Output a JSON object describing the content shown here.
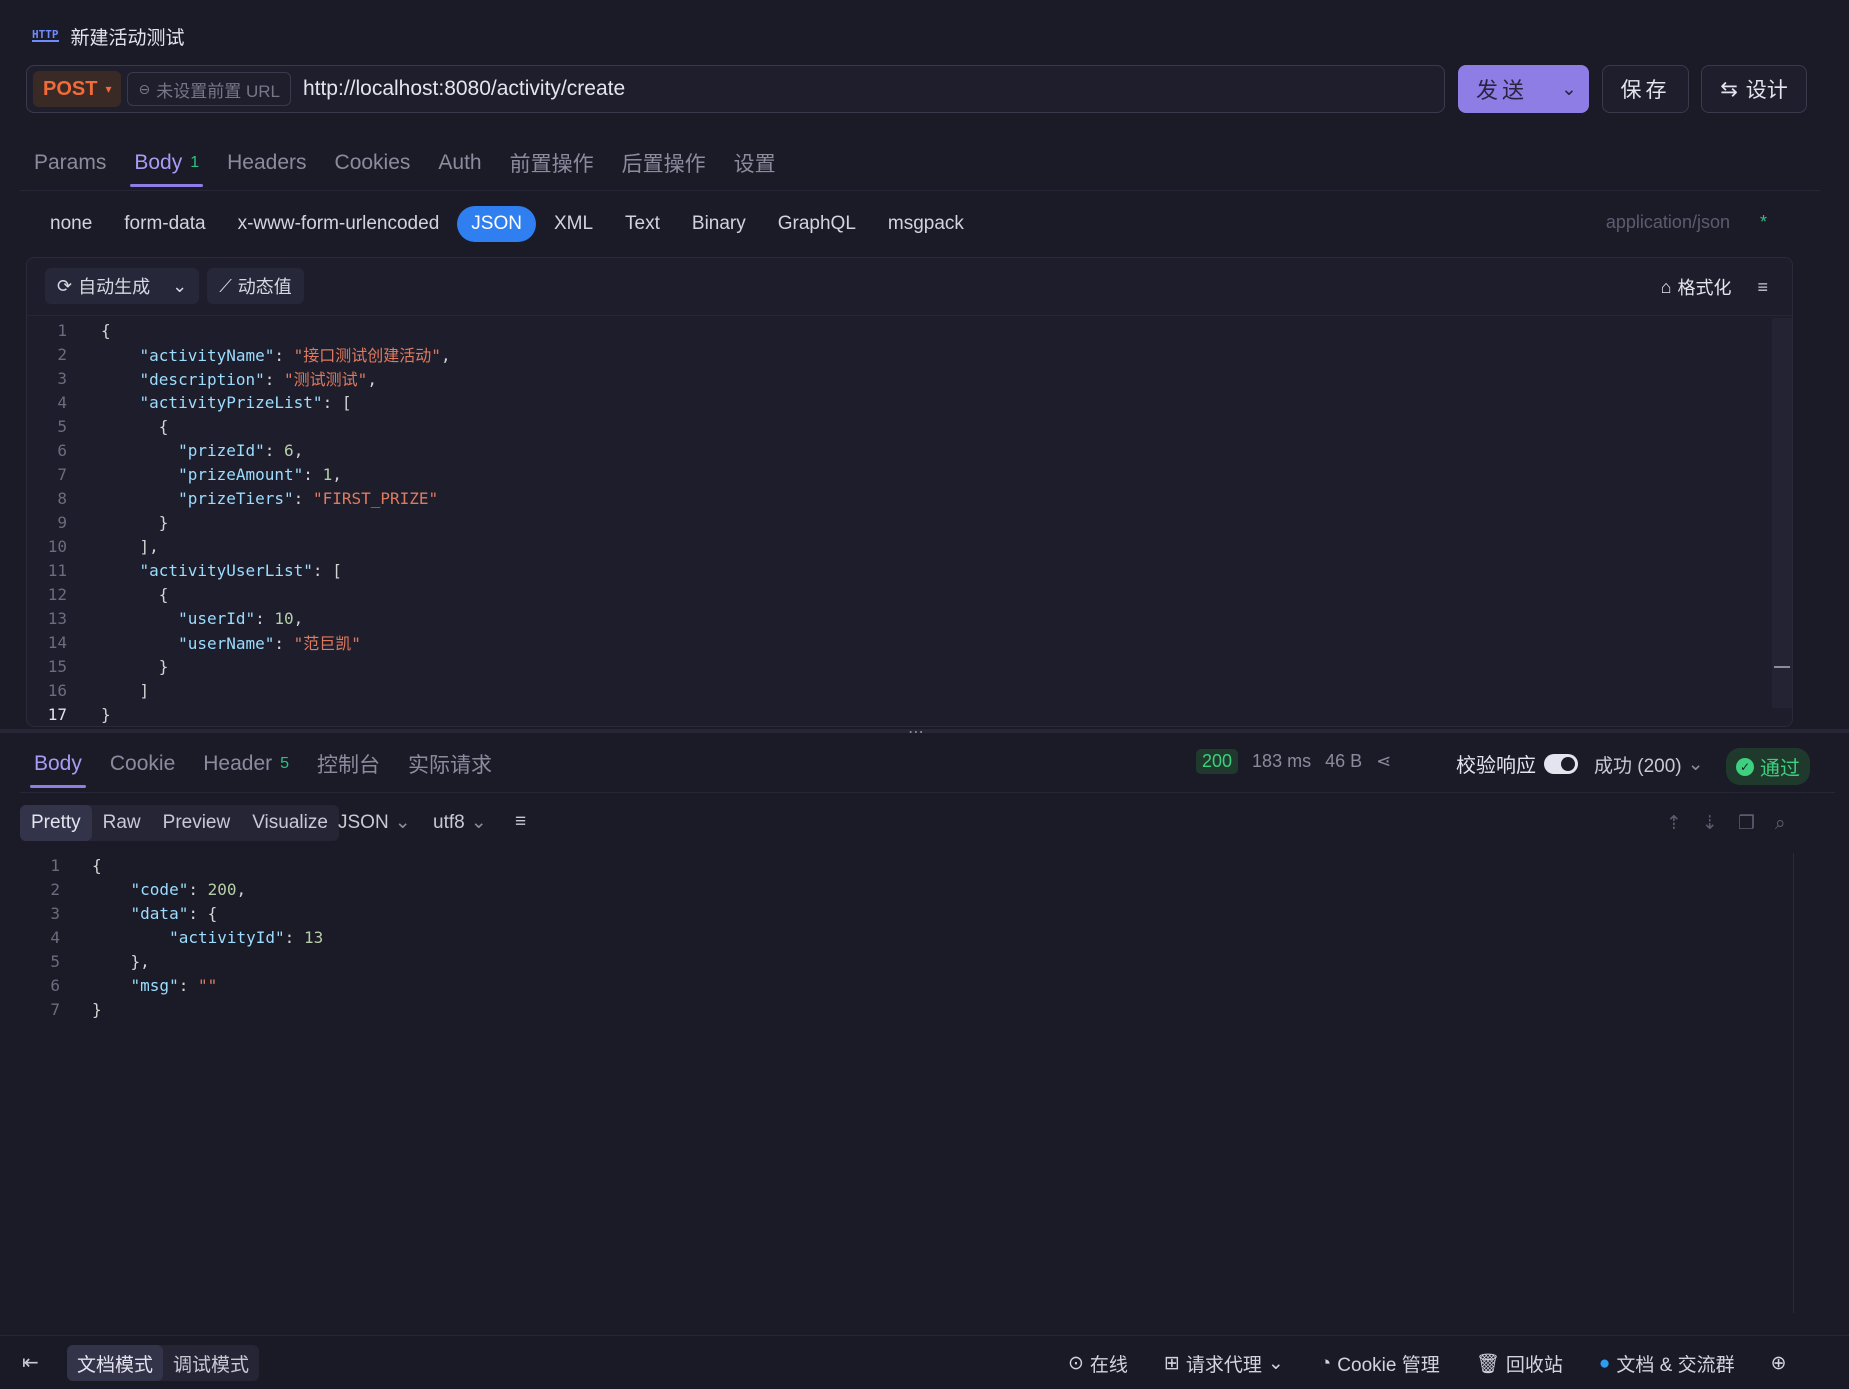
{
  "window": {
    "title": "新建活动测试"
  },
  "request": {
    "method": "POST",
    "prefix_label": "未设置前置 URL",
    "url": "http://localhost:8080/activity/create",
    "send_label": "发送",
    "save_label": "保存",
    "design_label": "设计"
  },
  "req_tabs": [
    {
      "label": "Params"
    },
    {
      "label": "Body",
      "badge": "1",
      "active": true
    },
    {
      "label": "Headers"
    },
    {
      "label": "Cookies"
    },
    {
      "label": "Auth"
    },
    {
      "label": "前置操作"
    },
    {
      "label": "后置操作"
    },
    {
      "label": "设置"
    }
  ],
  "body_types": [
    "none",
    "form-data",
    "x-www-form-urlencoded",
    "JSON",
    "XML",
    "Text",
    "Binary",
    "GraphQL",
    "msgpack"
  ],
  "body_type_active": "JSON",
  "content_type": "application/json",
  "content_type_required": "*",
  "editor_toolbar": {
    "auto_gen": "自动生成",
    "dynamic": "动态值",
    "format": "格式化"
  },
  "request_body_lines": [
    "{",
    "    \"activityName\": \"接口测试创建活动\",",
    "    \"description\": \"测试测试\",",
    "    \"activityPrizeList\": [",
    "      {",
    "        \"prizeId\": 6,",
    "        \"prizeAmount\": 1,",
    "        \"prizeTiers\": \"FIRST_PRIZE\"",
    "      }",
    "    ],",
    "    \"activityUserList\": [",
    "      {",
    "        \"userId\": 10,",
    "        \"userName\": \"范巨凯\"",
    "      }",
    "    ]",
    "}"
  ],
  "resp_tabs": [
    {
      "label": "Body",
      "active": true
    },
    {
      "label": "Cookie"
    },
    {
      "label": "Header",
      "badge": "5"
    },
    {
      "label": "控制台"
    },
    {
      "label": "实际请求"
    }
  ],
  "response_meta": {
    "status": "200",
    "time": "183 ms",
    "size": "46 B",
    "validate_label": "校验响应",
    "validate_select": "成功 (200)",
    "result": "通过"
  },
  "view_tabs": [
    "Pretty",
    "Raw",
    "Preview",
    "Visualize"
  ],
  "view_active": "Pretty",
  "format_select": "JSON",
  "encoding_select": "utf8",
  "response_body_lines": [
    "{",
    "    \"code\": 200,",
    "    \"data\": {",
    "        \"activityId\": 13",
    "    },",
    "    \"msg\": \"\"",
    "}"
  ],
  "statusbar": {
    "mode_doc": "文档模式",
    "mode_debug": "调试模式",
    "online": "在线",
    "proxy": "请求代理",
    "cookie": "Cookie 管理",
    "trash": "回收站",
    "docs": "文档 & 交流群"
  },
  "colors": {
    "accent": "#8f7de6",
    "method": "#f06a3a",
    "success": "#3ecf7f",
    "json_active": "#2f7ff0"
  }
}
